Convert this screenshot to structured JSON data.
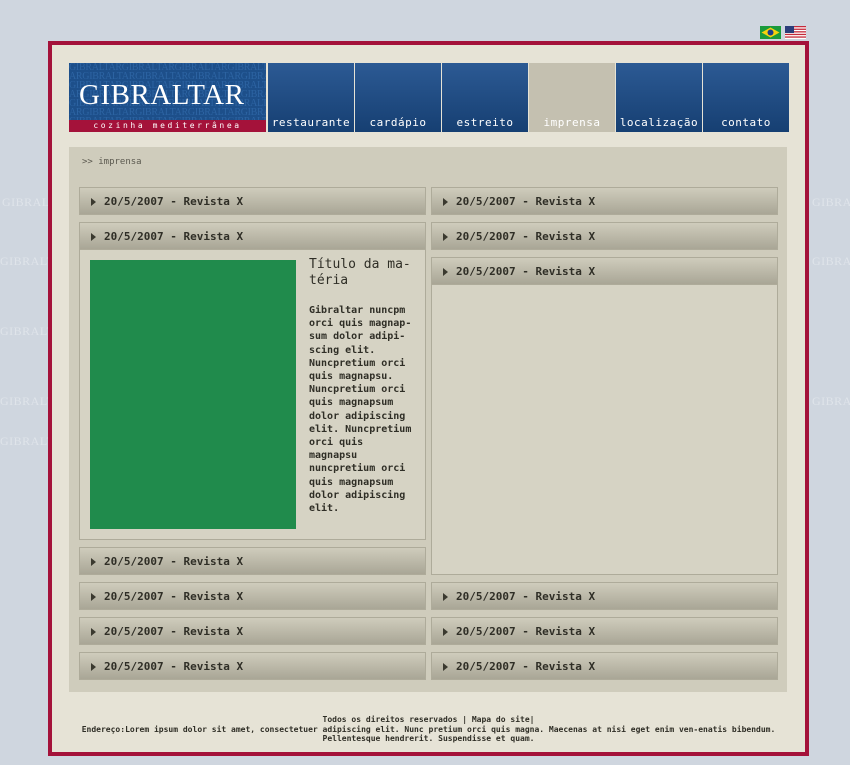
{
  "background_word": "GIBRALTAR",
  "flags": [
    {
      "name": "flag-brazil",
      "color": "#1a9b3c"
    },
    {
      "name": "flag-usa",
      "color": "#c42a3a"
    }
  ],
  "logo": {
    "name": "GIBRALTAR",
    "tagline": "cozinha mediterrânea",
    "pattern": "GIBRALTARGIBRALTARGIBRALTAR"
  },
  "nav": [
    {
      "label": "restaurante",
      "active": false
    },
    {
      "label": "cardápio",
      "active": false
    },
    {
      "label": "estreito",
      "active": false
    },
    {
      "label": "imprensa",
      "active": true
    },
    {
      "label": "localização",
      "active": false
    },
    {
      "label": "contato",
      "active": false
    }
  ],
  "breadcrumb": ">> imprensa",
  "items": {
    "left": [
      "20/5/2007 - Revista X",
      "20/5/2007 - Revista X",
      "20/5/2007 - Revista X",
      "20/5/2007 - Revista X",
      "20/5/2007 - Revista X",
      "20/5/2007 - Revista X"
    ],
    "right": [
      "20/5/2007 - Revista X",
      "20/5/2007 - Revista X",
      "20/5/2007 - Revista X",
      "20/5/2007 - Revista X",
      "20/5/2007 - Revista X",
      "20/5/2007 - Revista X"
    ]
  },
  "article": {
    "title": "Título da ma-téria",
    "body": "Gibraltar nuncpm orci quis magnap-sum dolor adipi-scing elit. Nuncpretium orci quis magnapsu. Nuncpretium orci quis magnapsum dolor adipiscing elit. Nuncpretium orci quis magnapsu nuncpretium orci quis magnapsum dolor adipiscing elit."
  },
  "footer": {
    "line1": "Todos os direitos reservados | Mapa do site|",
    "line2": "Endereço:Lorem ipsum dolor sit amet, consectetuer adipiscing elit. Nunc pretium orci quis magna. Maecenas at nisi eget enim ven-enatis bibendum. Pellentesque hendrerit. Suspendisse et quam."
  },
  "colors": {
    "frame": "#a4123a",
    "nav": "#1d4f8a",
    "thumbnail": "#208b4c"
  }
}
